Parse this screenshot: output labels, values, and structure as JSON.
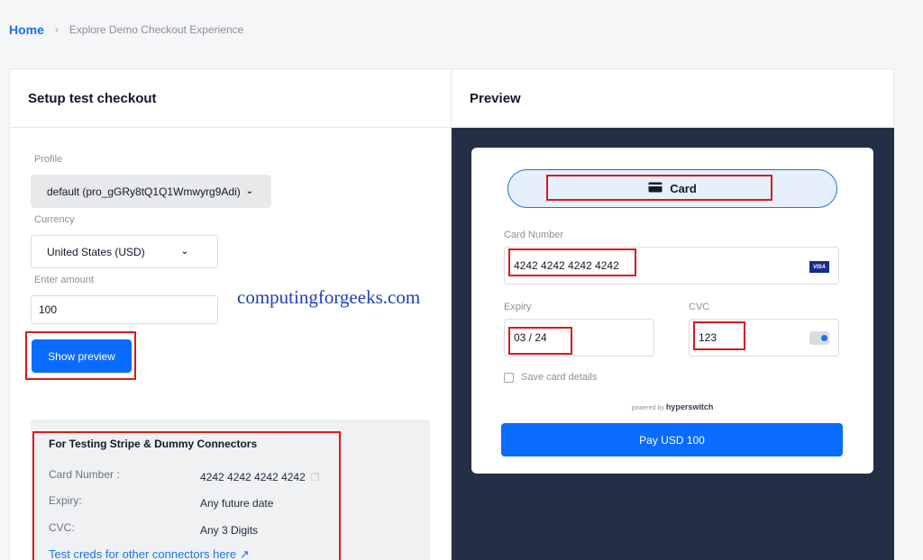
{
  "breadcrumb": {
    "home": "Home",
    "separator": "›",
    "current": "Explore Demo Checkout Experience"
  },
  "setup": {
    "title": "Setup test checkout",
    "profile_label": "Profile",
    "profile_value": "default (pro_gGRy8tQ1Q1Wmwyrg9Adi)",
    "currency_label": "Currency",
    "currency_value": "United States (USD)",
    "amount_label": "Enter amount",
    "amount_value": "100",
    "show_preview_label": "Show preview"
  },
  "watermark": "computingforgeeks.com",
  "test_creds": {
    "title": "For Testing Stripe & Dummy Connectors",
    "rows": [
      {
        "key": "Card Number :",
        "value": "4242 4242 4242 4242"
      },
      {
        "key": "Expiry:",
        "value": "Any future date"
      },
      {
        "key": "CVC:",
        "value": "Any 3 Digits"
      }
    ],
    "link": "Test creds for other connectors here ↗"
  },
  "preview": {
    "title": "Preview",
    "tab_label": "Card",
    "card_number_label": "Card Number",
    "card_number_value": "4242 4242 4242 4242",
    "card_brand": "VISA",
    "expiry_label": "Expiry",
    "expiry_value": "03 / 24",
    "cvc_label": "CVC",
    "cvc_value": "123",
    "save_card_label": "Save card details",
    "powered_prefix": "powered by",
    "powered_brand": "hyperswitch",
    "pay_label": "Pay USD 100"
  },
  "colors": {
    "accent": "#0a6cff",
    "highlight_box": "#d91a1a",
    "preview_bg": "#242f46"
  },
  "icons": {
    "copy": "copy-icon",
    "card": "credit-card-icon",
    "dropdown": "chevron-down-icon"
  }
}
